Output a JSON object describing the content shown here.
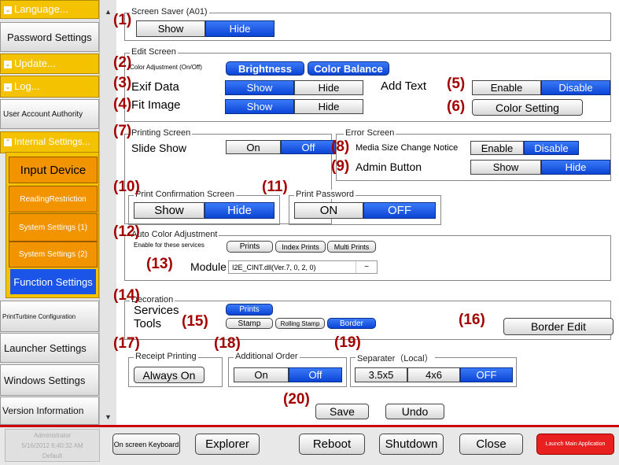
{
  "sidebar": {
    "language": "Language...",
    "password_settings": "Password Settings",
    "update": "Update...",
    "log": "Log...",
    "user_account_authority": "User Account Authority",
    "internal_settings": "Internal Settings...",
    "input_device": "Input Device",
    "reading_restriction": "ReadingRestriction",
    "system_settings_1": "System Settings (1)",
    "system_settings_2": "System Settings (2)",
    "function_settings": "Function Settings",
    "printturbine_configuration": "PrintTurbine Configuration",
    "launcher_settings": "Launcher Settings",
    "windows_settings": "Windows Settings",
    "version_information": "Version Information"
  },
  "screen_saver": {
    "title": "Screen Saver (A01)",
    "show": "Show",
    "hide": "Hide",
    "selected": "Hide"
  },
  "edit_screen": {
    "title": "Edit Screen",
    "color_adjustment_label": "Color Adjustment (On/Off)",
    "brightness": "Brightness",
    "color_balance": "Color Balance",
    "exif_data": "Exif Data",
    "exif_show": "Show",
    "exif_hide": "Hide",
    "add_text": "Add Text",
    "add_text_enable": "Enable",
    "add_text_disable": "Disable",
    "fit_image": "Fit Image",
    "fit_show": "Show",
    "fit_hide": "Hide",
    "color_setting": "Color Setting"
  },
  "printing_screen": {
    "title": "Printing Screen",
    "slide_show": "Slide Show",
    "on": "On",
    "off": "Off"
  },
  "error_screen": {
    "title": "Error Screen",
    "media_size_change_notice": "Media Size Change Notice",
    "enable": "Enable",
    "disable": "Disable",
    "admin_button": "Admin Button",
    "show": "Show",
    "hide": "Hide"
  },
  "print_confirmation": {
    "title": "Print Confirmation Screen",
    "show": "Show",
    "hide": "Hide"
  },
  "print_password": {
    "title": "Print Password",
    "on": "ON",
    "off": "OFF"
  },
  "auto_color": {
    "title": "Auto Color Adjustment",
    "enable_label": "Enable for these services",
    "prints": "Prints",
    "index_prints": "Index Prints",
    "multi_prints": "Multi Prints",
    "module_label": "Module",
    "module_value": "I2E_CINT.dll(Ver.7, 0, 2, 0)"
  },
  "decoration": {
    "title": "Decoration",
    "services": "Services",
    "prints": "Prints",
    "tools": "Tools",
    "stamp": "Stamp",
    "rolling_stamp": "Rolling Stamp",
    "border": "Border",
    "border_edit": "Border Edit"
  },
  "receipt_printing": {
    "title": "Receipt Printing",
    "always_on": "Always On"
  },
  "additional_order": {
    "title": "Additional Order",
    "on": "On",
    "off": "Off"
  },
  "separater": {
    "title": "Separater（Local）",
    "a": "3.5x5",
    "b": "4x6",
    "off": "OFF"
  },
  "actions": {
    "save": "Save",
    "undo": "Undo"
  },
  "callouts": [
    "(1)",
    "(2)",
    "(3)",
    "(4)",
    "(5)",
    "(6)",
    "(7)",
    "(8)",
    "(9)",
    "(10)",
    "(11)",
    "(12)",
    "(13)",
    "(14)",
    "(15)",
    "(16)",
    "(17)",
    "(18)",
    "(19)",
    "(20)"
  ],
  "footer": {
    "user": "Administrator",
    "datetime": "5/16/2012 6:40:32 AM",
    "profile": "Default",
    "on_screen_keyboard": "On screen Keyboard",
    "explorer": "Explorer",
    "reboot": "Reboot",
    "shutdown": "Shutdown",
    "close": "Close",
    "launch_main_application": "Launch Main Application"
  },
  "colors": {
    "accent_blue": "#0b45d6",
    "sidebar_yellow": "#f5c200",
    "sidebar_orange": "#f29400",
    "callout_red": "#a30000",
    "launch_red": "#e82020"
  }
}
